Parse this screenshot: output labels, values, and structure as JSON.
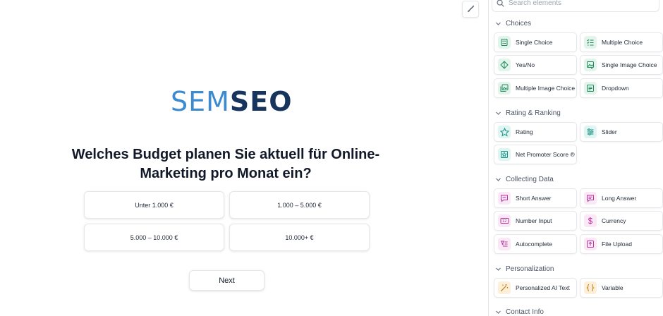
{
  "preview": {
    "logo_part1": "SEM",
    "logo_part2": "SEO",
    "question": "Welches Budget planen Sie aktuell für Online-Marketing pro Monat ein?",
    "answers": [
      "Unter 1.000 €",
      "1.000 – 5.000 €",
      "5.000 – 10.000 €",
      "10.000+ €"
    ],
    "next_label": "Next"
  },
  "panel": {
    "search_placeholder": "Search elements",
    "sections": [
      {
        "title": "Choices",
        "items": [
          {
            "label": "Single Choice",
            "icon": "single-choice-icon",
            "color": "#1f8a5a"
          },
          {
            "label": "Multiple Choice",
            "icon": "multiple-choice-icon",
            "color": "#1f8a5a"
          },
          {
            "label": "Yes/No",
            "icon": "yes-no-icon",
            "color": "#1f8a5a"
          },
          {
            "label": "Single Image Choice",
            "icon": "image-choice-icon",
            "color": "#1f8a5a"
          },
          {
            "label": "Multiple Image Choice",
            "icon": "multiple-image-icon",
            "color": "#1f8a5a"
          },
          {
            "label": "Dropdown",
            "icon": "dropdown-icon",
            "color": "#1f8a5a"
          }
        ]
      },
      {
        "title": "Rating & Ranking",
        "items": [
          {
            "label": "Rating",
            "icon": "star-icon",
            "color": "#1a8f84"
          },
          {
            "label": "Slider",
            "icon": "slider-icon",
            "color": "#1a8f84"
          },
          {
            "label": "Net Promoter Score ®",
            "icon": "nps-icon",
            "color": "#1a8f84"
          }
        ]
      },
      {
        "title": "Collecting Data",
        "items": [
          {
            "label": "Short Answer",
            "icon": "short-answer-icon",
            "color": "#b5369a"
          },
          {
            "label": "Long Answer",
            "icon": "long-answer-icon",
            "color": "#b5369a"
          },
          {
            "label": "Number Input",
            "icon": "number-input-icon",
            "color": "#b5369a"
          },
          {
            "label": "Currency",
            "icon": "currency-icon",
            "color": "#b5369a"
          },
          {
            "label": "Autocomplete",
            "icon": "autocomplete-icon",
            "color": "#b5369a"
          },
          {
            "label": "File Upload",
            "icon": "file-upload-icon",
            "color": "#b5369a"
          }
        ]
      },
      {
        "title": "Personalization",
        "items": [
          {
            "label": "Personalized AI Text",
            "icon": "magic-wand-icon",
            "color": "#c07a12"
          },
          {
            "label": "Variable",
            "icon": "braces-icon",
            "color": "#c07a12"
          }
        ]
      },
      {
        "title": "Contact Info",
        "items": []
      }
    ]
  }
}
